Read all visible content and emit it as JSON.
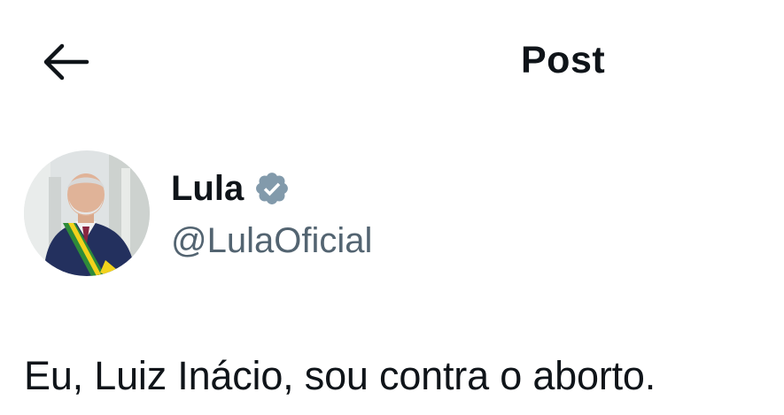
{
  "header": {
    "title": "Post",
    "back_icon": "arrow-left-icon"
  },
  "author": {
    "name": "Lula",
    "handle": "@LulaOficial",
    "verified": true,
    "verified_icon": "verified-badge-icon",
    "verified_color": "#829aab"
  },
  "post": {
    "text": "Eu, Luiz Inácio, sou contra o aborto."
  },
  "colors": {
    "text_primary": "#0f1419",
    "text_secondary": "#536471",
    "background": "#ffffff"
  }
}
